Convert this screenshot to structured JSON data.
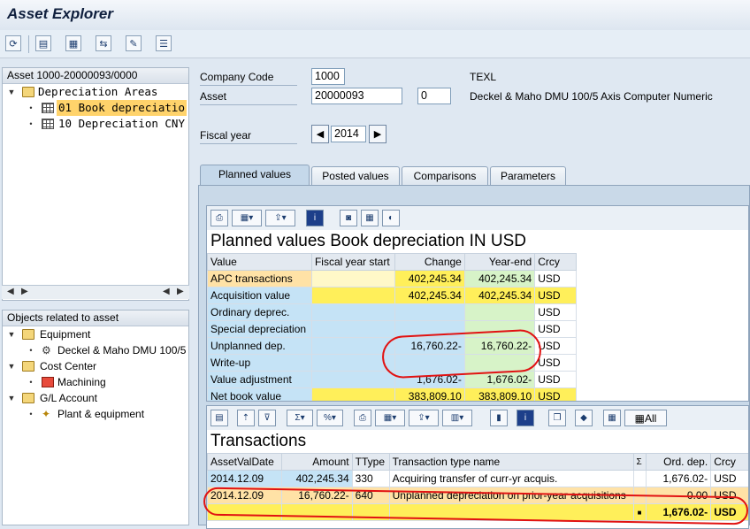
{
  "window": {
    "title": "Asset Explorer"
  },
  "toolbar": {
    "icons": [
      "refresh-icon",
      "master-data-icon",
      "asset-values-icon",
      "switch-icon",
      "change-icon",
      "list-icon"
    ]
  },
  "left": {
    "asset_tree": {
      "header": "Asset 1000-20000093/0000",
      "root": "Depreciation Areas",
      "items": [
        "01 Book depreciatio",
        "10 Depreciation CNY"
      ]
    },
    "objects": {
      "header": "Objects related to asset",
      "groups": [
        {
          "label": "Equipment",
          "child": "Deckel & Maho DMU 100/5"
        },
        {
          "label": "Cost Center",
          "child": "Machining"
        },
        {
          "label": "G/L Account",
          "child": "Plant & equipment"
        }
      ]
    }
  },
  "header": {
    "company_code_label": "Company Code",
    "company_code": "1000",
    "company_name": "TEXL",
    "asset_label": "Asset",
    "asset": "20000093",
    "subnumber": "0",
    "asset_desc": "Deckel & Maho DMU 100/5 Axis Computer Numeric",
    "fiscal_year_label": "Fiscal year",
    "fiscal_year": "2014"
  },
  "tabs": [
    "Planned values",
    "Posted values",
    "Comparisons",
    "Parameters"
  ],
  "planned": {
    "title": "Planned values Book depreciation IN USD",
    "columns": [
      "Value",
      "Fiscal year start",
      "Change",
      "Year-end",
      "Crcy"
    ],
    "rows": [
      {
        "value": "APC transactions",
        "start": "",
        "change": "402,245.34",
        "end": "402,245.34",
        "crcy": "USD"
      },
      {
        "value": "Acquisition value",
        "start": "",
        "change": "402,245.34",
        "end": "402,245.34",
        "crcy": "USD"
      },
      {
        "value": "Ordinary deprec.",
        "start": "",
        "change": "",
        "end": "",
        "crcy": "USD"
      },
      {
        "value": "Special depreciation",
        "start": "",
        "change": "",
        "end": "",
        "crcy": "USD"
      },
      {
        "value": "Unplanned dep.",
        "start": "",
        "change": "16,760.22-",
        "end": "16,760.22-",
        "crcy": "USD"
      },
      {
        "value": "Write-up",
        "start": "",
        "change": "",
        "end": "",
        "crcy": "USD"
      },
      {
        "value": "Value adjustment",
        "start": "",
        "change": "1,676.02-",
        "end": "1,676.02-",
        "crcy": "USD"
      },
      {
        "value": "Net book value",
        "start": "",
        "change": "383,809.10",
        "end": "383,809.10",
        "crcy": "USD"
      }
    ]
  },
  "transactions": {
    "title": "Transactions",
    "all_label": "All",
    "columns": [
      "AssetValDate",
      "Amount",
      "TType",
      "Transaction type name",
      "Σ",
      "Ord. dep.",
      "Crcy"
    ],
    "rows": [
      {
        "date": "2014.12.09",
        "amount": "402,245.34",
        "ttype": "330",
        "name": "Acquiring transfer of curr-yr acquis.",
        "ord": "1,676.02-",
        "crcy": "USD"
      },
      {
        "date": "2014.12.09",
        "amount": "16,760.22-",
        "ttype": "640",
        "name": "Unplanned depreciation on prior-year acquisitions",
        "ord": "0.00",
        "crcy": "USD"
      }
    ],
    "total": {
      "marker": "■",
      "ord": "1,676.02-",
      "crcy": "USD"
    }
  }
}
